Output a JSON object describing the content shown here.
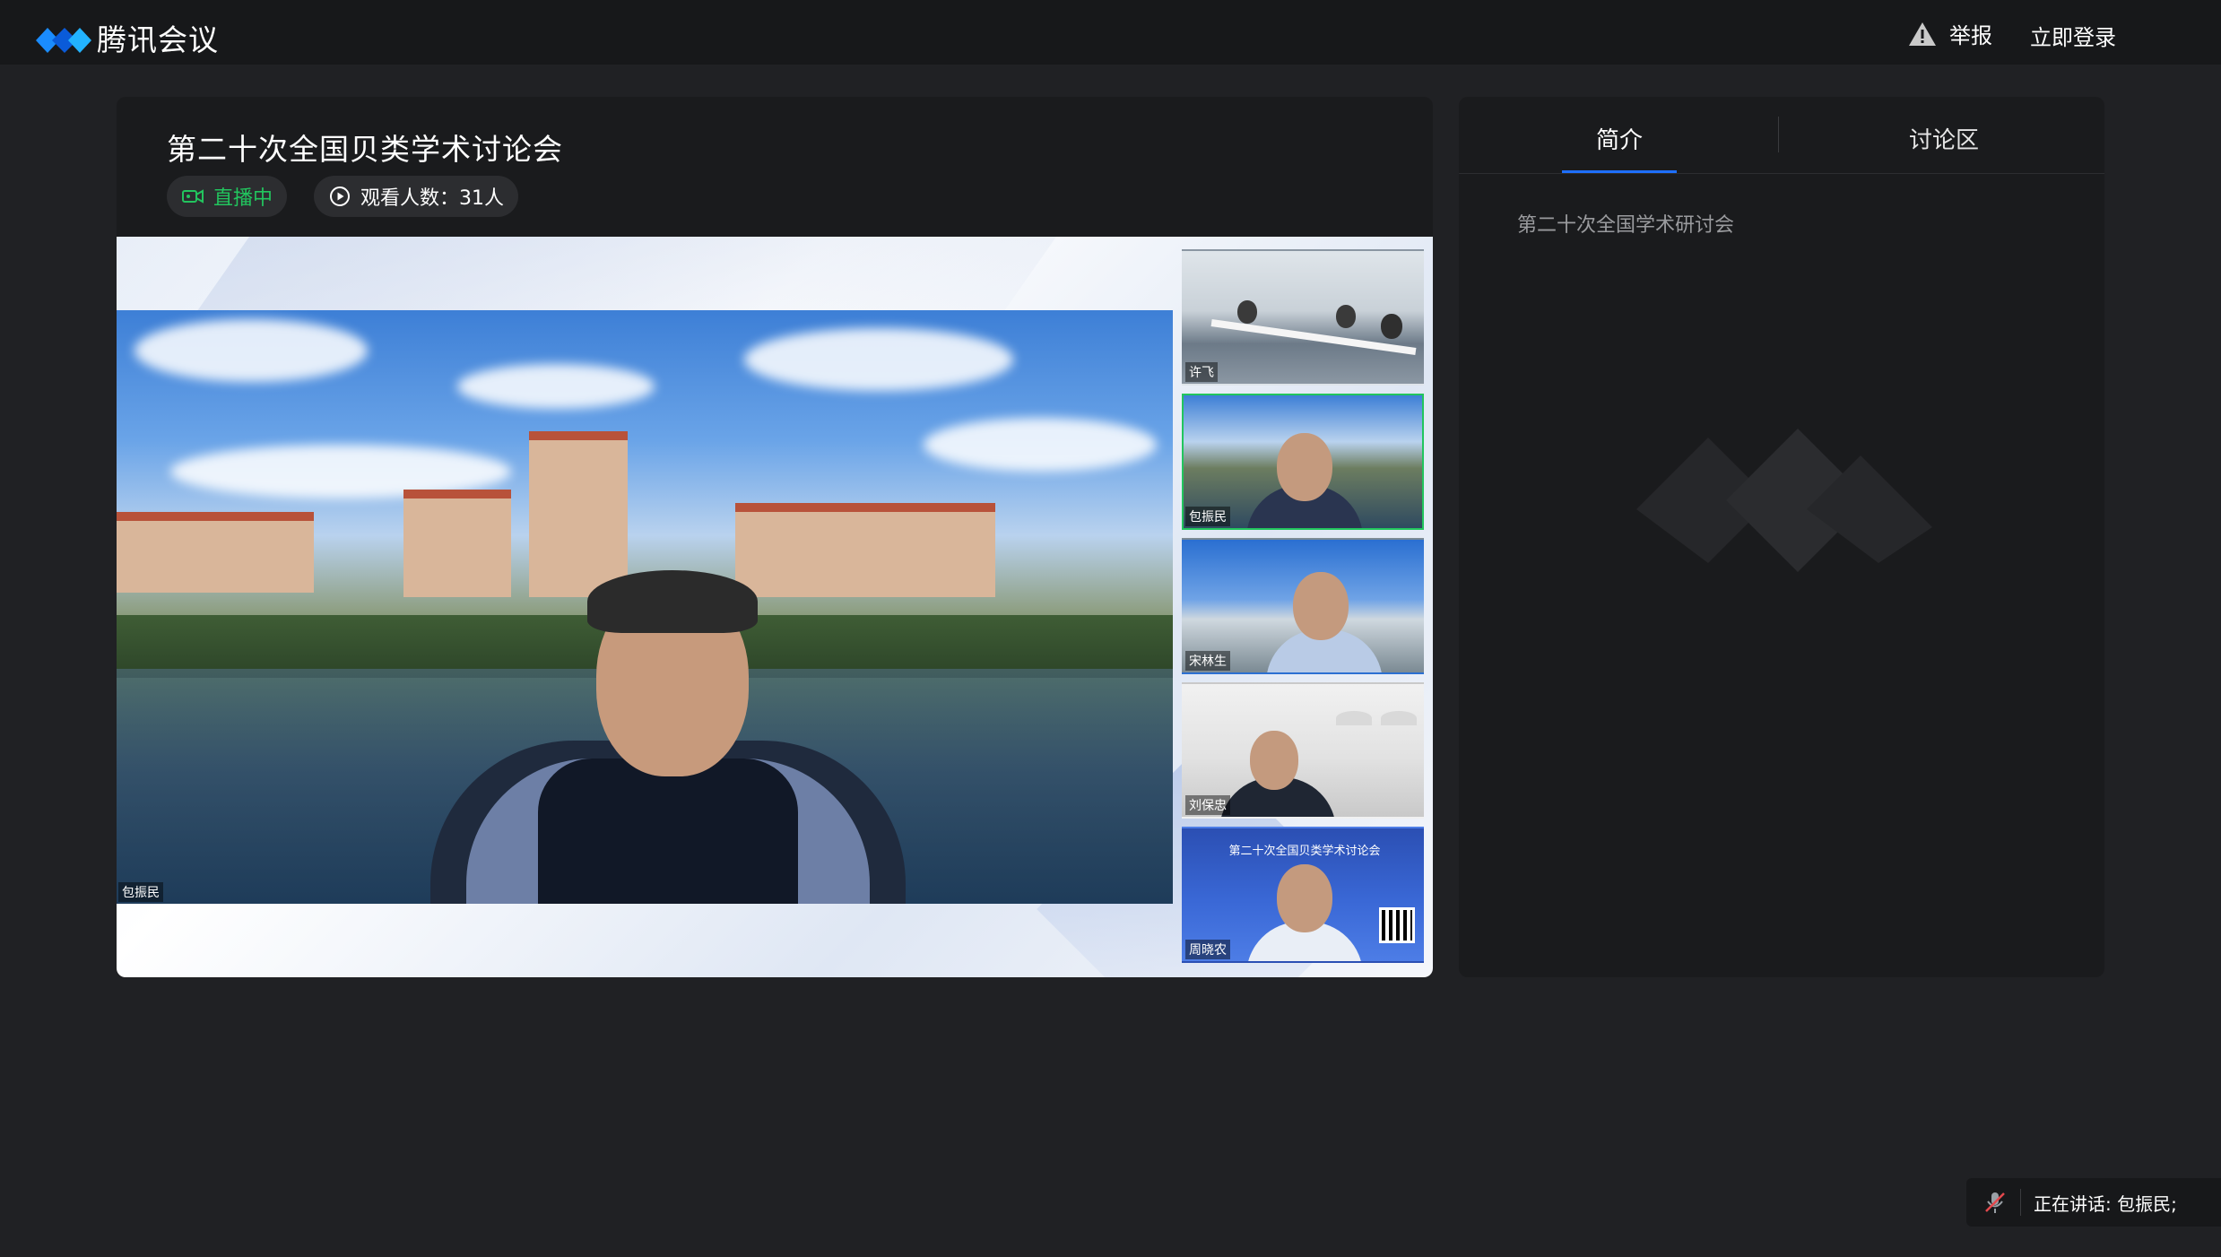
{
  "app": {
    "name": "腾讯会议"
  },
  "topbar": {
    "report_label": "举报",
    "login_label": "立即登录"
  },
  "meeting": {
    "title": "第二十次全国贝类学术讨论会",
    "live_status": "直播中",
    "viewers_label": "观看人数：31人"
  },
  "main_video": {
    "speaker_name": "包振民"
  },
  "participants": [
    {
      "name": "许飞"
    },
    {
      "name": "包振民",
      "active": true
    },
    {
      "name": "宋林生"
    },
    {
      "name": "刘保忠"
    },
    {
      "name": "周晓农"
    }
  ],
  "slide_thumb": {
    "title": "第二十次全国贝类学术讨论会"
  },
  "side_panel": {
    "tabs": [
      {
        "label": "简介",
        "selected": true
      },
      {
        "label": "讨论区",
        "selected": false
      }
    ],
    "intro_text": "第二十次全国学术研讨会"
  },
  "status": {
    "speaking_text": "正在讲话: 包振民;"
  },
  "colors": {
    "accent": "#1e6fff",
    "live": "#22c55e",
    "background": "#202124",
    "panel": "#1a1b1d"
  },
  "icons": [
    "tencent-meeting-logo-icon",
    "warning-icon",
    "video-camera-icon",
    "play-circle-icon",
    "muted-mic-icon",
    "watermark-logo-icon"
  ]
}
